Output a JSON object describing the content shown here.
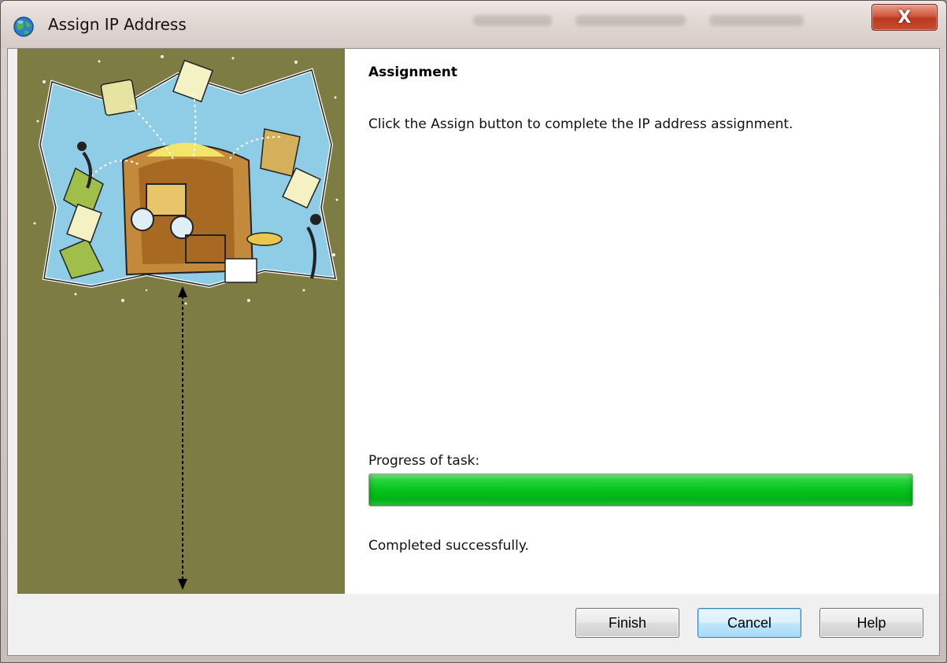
{
  "window": {
    "title": "Assign IP Address",
    "icon": "globe-network-icon",
    "close_label": "X"
  },
  "page": {
    "heading": "Assignment",
    "instruction": "Click the Assign button to complete the IP address assignment.",
    "progress_label": "Progress of task:",
    "progress_percent": 100,
    "status": "Completed successfully."
  },
  "buttons": {
    "finish": "Finish",
    "cancel": "Cancel",
    "help": "Help"
  },
  "colors": {
    "side_panel": "#7d7c42",
    "progress_fill": "#06c21c",
    "default_button_border": "#3c7fb1"
  }
}
